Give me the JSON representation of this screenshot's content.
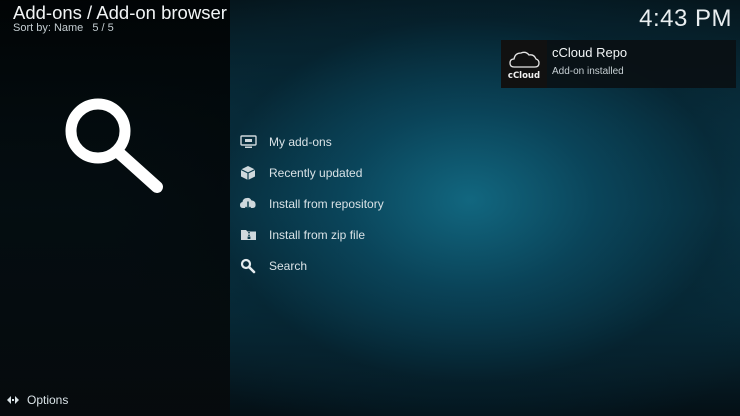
{
  "header": {
    "title": "Add-ons / Add-on browser",
    "sort_label": "Sort by: Name",
    "count": "5 / 5"
  },
  "clock": "4:43 PM",
  "hero_icon": "search-icon",
  "menu": {
    "items": [
      {
        "label": "My add-ons",
        "icon": "monitor-icon"
      },
      {
        "label": "Recently updated",
        "icon": "box-icon"
      },
      {
        "label": "Install from repository",
        "icon": "cloud-download-icon"
      },
      {
        "label": "Install from zip file",
        "icon": "zip-folder-icon"
      },
      {
        "label": "Search",
        "icon": "search-icon"
      }
    ]
  },
  "notification": {
    "thumb_text": "cCloud",
    "title": "cCloud Repo",
    "message": "Add-on installed"
  },
  "footer": {
    "options_label": "Options",
    "options_icon": "options-arrows-icon"
  },
  "colors": {
    "accent_blue": "#0b4f66",
    "panel_dark": "#05090b",
    "text": "#d9e2e6"
  }
}
